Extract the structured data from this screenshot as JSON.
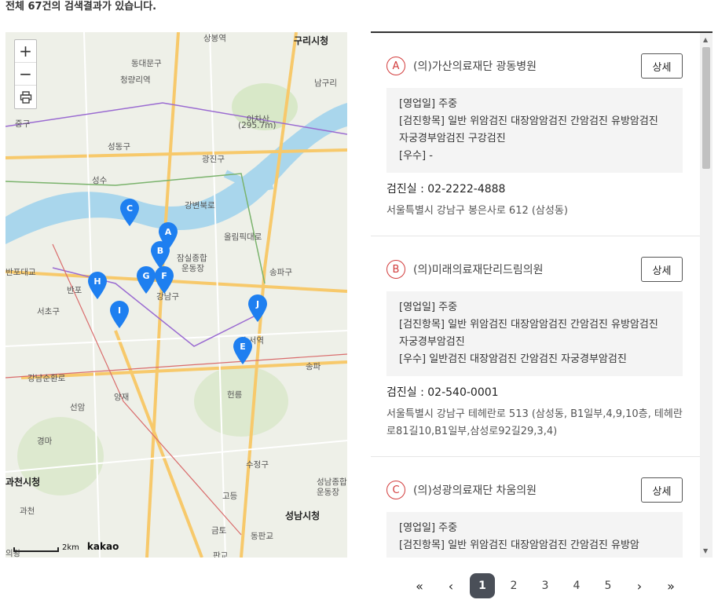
{
  "summary": "전체 67건의 검색결과가 있습니다.",
  "map": {
    "zoom_in": "+",
    "zoom_out": "−",
    "print_icon": "printer-icon",
    "scale_label": "2km",
    "brand": "kakao",
    "places": [
      {
        "name": "상봉역"
      },
      {
        "name": "구리시청",
        "big": true
      },
      {
        "name": "동대문구"
      },
      {
        "name": "청량리역"
      },
      {
        "name": "남구리"
      },
      {
        "name": "아차산"
      },
      {
        "name": "(295.7m)"
      },
      {
        "name": "중구"
      },
      {
        "name": "성동구"
      },
      {
        "name": "광진구"
      },
      {
        "name": "성수"
      },
      {
        "name": "강변북로"
      },
      {
        "name": "올림픽대로"
      },
      {
        "name": "잠실종합"
      },
      {
        "name": "운동장"
      },
      {
        "name": "송파구"
      },
      {
        "name": "반포대교"
      },
      {
        "name": "반포"
      },
      {
        "name": "강남구"
      },
      {
        "name": "서초구"
      },
      {
        "name": "수서역"
      },
      {
        "name": "송파"
      },
      {
        "name": "강남순환로"
      },
      {
        "name": "양재"
      },
      {
        "name": "선암"
      },
      {
        "name": "헌릉"
      },
      {
        "name": "경마"
      },
      {
        "name": "과천시청",
        "big": true
      },
      {
        "name": "수정구"
      },
      {
        "name": "성남종합"
      },
      {
        "name": "운동장"
      },
      {
        "name": "고등"
      },
      {
        "name": "과천"
      },
      {
        "name": "성남시청",
        "big": true
      },
      {
        "name": "금토"
      },
      {
        "name": "판교"
      },
      {
        "name": "동판교"
      },
      {
        "name": "의왕"
      }
    ],
    "markers": [
      "A",
      "B",
      "C",
      "E",
      "F",
      "G",
      "H",
      "I",
      "J"
    ],
    "marker_color": "#1e7ff0"
  },
  "results": [
    {
      "letter": "A",
      "name": "(의)가산의료재단 광동병원",
      "detail_label": "상세",
      "lines": [
        "[영업일] 주중",
        "[검진항목] 일반 위암검진 대장암암검진 간암검진 유방암검진 자궁경부암검진 구강검진",
        "[우수] -"
      ],
      "phone_label": "검진실 :",
      "phone": "02-2222-4888",
      "address": "서울특별시 강남구 봉은사로 612 (삼성동)"
    },
    {
      "letter": "B",
      "name": "(의)미래의료재단리드림의원",
      "detail_label": "상세",
      "lines": [
        "[영업일] 주중",
        "[검진항목] 일반 위암검진 대장암암검진 간암검진 유방암검진 자궁경부암검진",
        "[우수] 일반검진 대장암검진 간암검진 자궁경부암검진"
      ],
      "phone_label": "검진실 :",
      "phone": "02-540-0001",
      "address": "서울특별시 강남구 테헤란로 513 (삼성동, B1일부,4,9,10층, 테헤란로81길10,B1일부,삼성로92길29,3,4)"
    },
    {
      "letter": "C",
      "name": "(의)성광의료재단 차움의원",
      "detail_label": "상세",
      "lines": [
        "[영업일] 주중",
        "[검진항목] 일반 위암검진 대장암암검진 간암검진 유방암"
      ],
      "phone_label": "",
      "phone": "",
      "address": ""
    }
  ],
  "pagination": {
    "first": "«",
    "prev": "‹",
    "pages": [
      "1",
      "2",
      "3",
      "4",
      "5"
    ],
    "current": "1",
    "next": "›",
    "last": "»"
  },
  "colors": {
    "accent_red": "#d23b3b",
    "page_active": "#4a4f58",
    "river": "#a9d6ec"
  }
}
